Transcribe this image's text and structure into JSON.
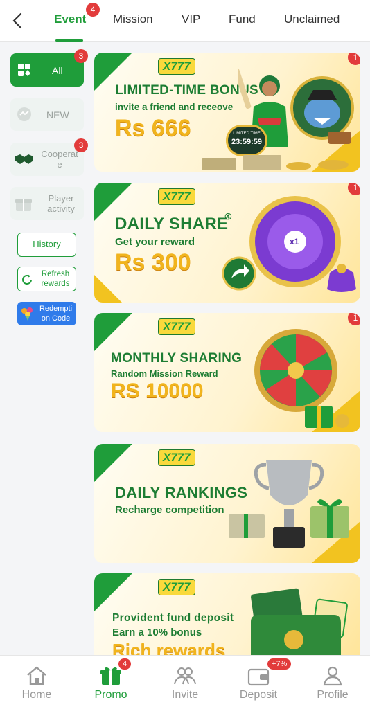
{
  "tabs": [
    {
      "label": "Event",
      "active": true,
      "badge": "4"
    },
    {
      "label": "Mission"
    },
    {
      "label": "VIP"
    },
    {
      "label": "Fund"
    },
    {
      "label": "Unclaimed"
    }
  ],
  "sidebar": {
    "all": {
      "label": "All",
      "badge": "3"
    },
    "new": {
      "label": "NEW"
    },
    "cooperate": {
      "label": "Cooperat e",
      "badge": "3"
    },
    "player_activity": {
      "label": "Player activity"
    },
    "history": {
      "label": "History"
    },
    "refresh": {
      "label": "Refresh rewards"
    },
    "redemption": {
      "label": "Redempti on Code"
    }
  },
  "banners": [
    {
      "badge": "1",
      "logo": "X777",
      "title": "LIMITED-TIME BONUS",
      "subtitle": "invite a friend and receove",
      "amount": "Rs 666",
      "timer_label": "LIMITED TIME",
      "timer": "23:59:59"
    },
    {
      "badge": "1",
      "logo": "X777",
      "title": "DAILY SHARE",
      "title_marker": "④",
      "subtitle": "Get your reward",
      "amount": "Rs 300",
      "wheel_center": "x1"
    },
    {
      "badge": "1",
      "logo": "X777",
      "title": "MONTHLY SHARING",
      "subtitle": "Random Mission Reward",
      "amount": "RS 10000"
    },
    {
      "logo": "X777",
      "title": "DAILY RANKINGS",
      "subtitle": "Recharge competition"
    },
    {
      "logo": "X777",
      "title": "Provident fund deposit",
      "subtitle": "Earn a 10% bonus",
      "amount": "Rich rewards"
    }
  ],
  "bottom_nav": [
    {
      "label": "Home",
      "icon": "home-icon"
    },
    {
      "label": "Promo",
      "icon": "gift-icon",
      "active": true,
      "badge": "4"
    },
    {
      "label": "Invite",
      "icon": "users-icon"
    },
    {
      "label": "Deposit",
      "icon": "wallet-icon",
      "badge": "+7%"
    },
    {
      "label": "Profile",
      "icon": "person-icon"
    }
  ],
  "colors": {
    "accent": "#1f9d3a",
    "badge": "#e23b3b",
    "gold": "#f1b41d"
  }
}
